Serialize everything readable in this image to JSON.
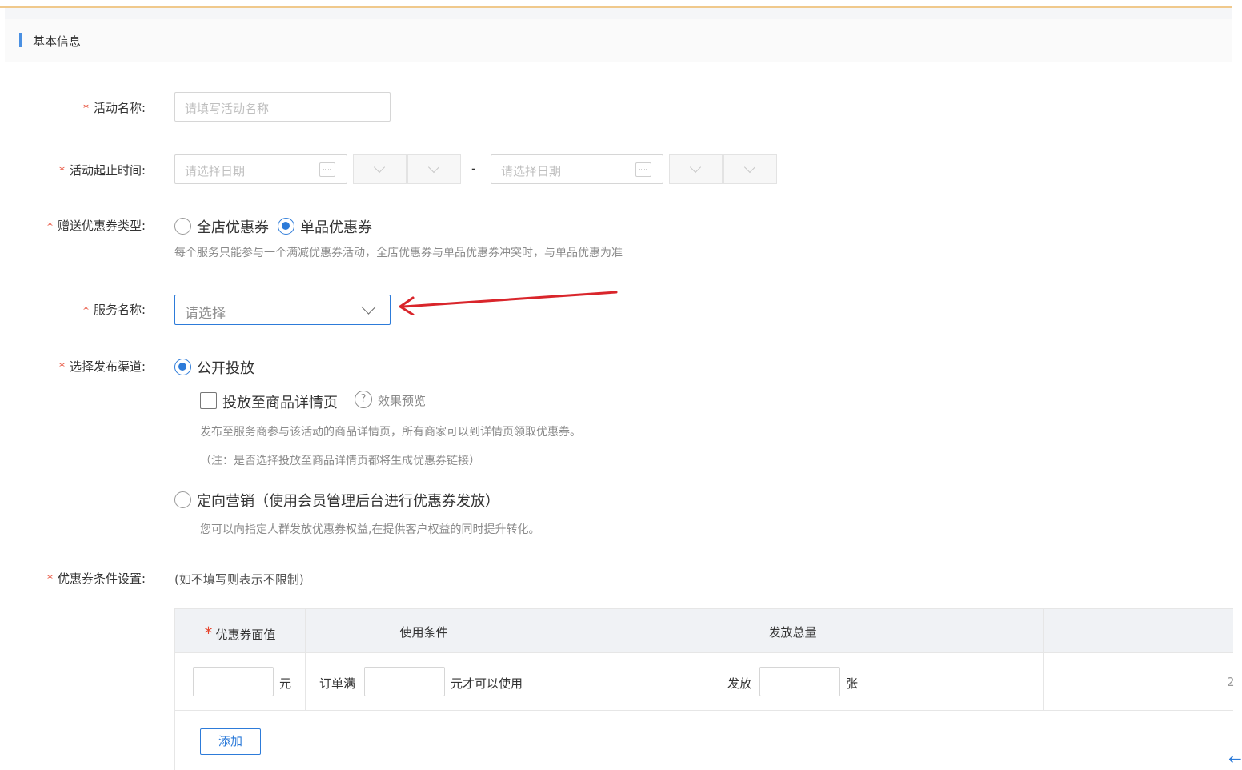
{
  "section": {
    "title": "基本信息"
  },
  "form": {
    "activity_name": {
      "label": "活动名称:",
      "placeholder": "请填写活动名称"
    },
    "activity_time": {
      "label": "活动起止时间:",
      "start_placeholder": "请选择日期",
      "end_placeholder": "请选择日期",
      "separator": "-"
    },
    "coupon_type": {
      "label": "赠送优惠券类型:",
      "options": [
        {
          "label": "全店优惠券",
          "selected": false
        },
        {
          "label": "单品优惠券",
          "selected": true
        }
      ],
      "hint": "每个服务只能参与一个满减优惠券活动，全店优惠券与单品优惠券冲突时，与单品优惠为准"
    },
    "service_name": {
      "label": "服务名称:",
      "placeholder": "请选择"
    },
    "channel": {
      "label": "选择发布渠道:",
      "public": {
        "label": "公开投放",
        "selected": true
      },
      "detail_page": {
        "label": "投放至商品详情页",
        "checked": false,
        "preview_label": "效果预览",
        "hint1": "发布至服务商参与该活动的商品详情页，所有商家可以到详情页领取优惠券。",
        "hint2": "（注：是否选择投放至商品详情页都将生成优惠券链接）"
      },
      "targeted": {
        "label": "定向营销（使用会员管理后台进行优惠券发放）",
        "selected": false,
        "hint": "您可以向指定人群发放优惠券权益,在提供客户权益的同时提升转化。"
      }
    },
    "conditions": {
      "label": "优惠券条件设置:",
      "note": "(如不填写则表示不限制)",
      "columns": [
        "优惠券面值",
        "使用条件",
        "发放总量"
      ],
      "row": {
        "unit_yuan": "元",
        "order_prefix": "订单满",
        "order_suffix": "元才可以使用",
        "issue_prefix": "发放",
        "issue_suffix": "张",
        "trailing": "2"
      },
      "add_label": "添加"
    }
  },
  "required_mark": "*",
  "colors": {
    "accent": "#2d7bd9",
    "required": "#e6442d",
    "arrow": "#d9252b"
  }
}
